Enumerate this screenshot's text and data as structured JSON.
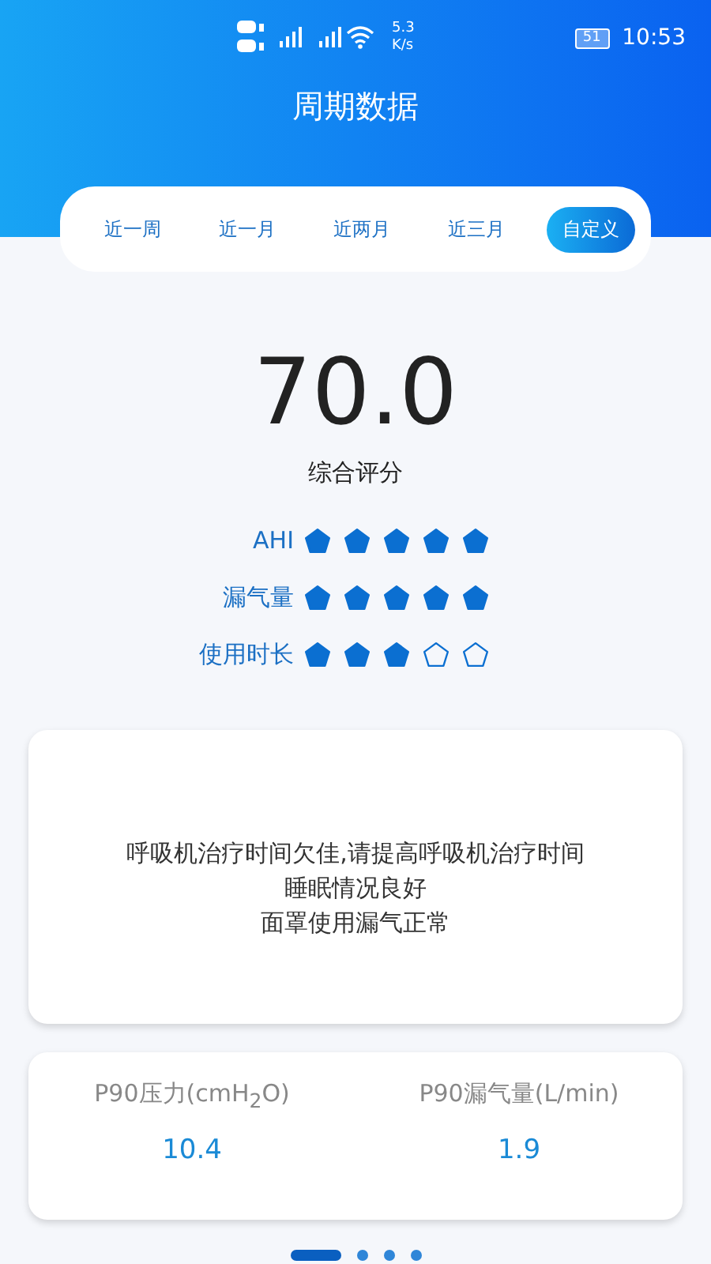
{
  "status_bar": {
    "speed_value": "5.3",
    "speed_unit": "K/s",
    "battery": "51",
    "time": "10:53"
  },
  "title": "周期数据",
  "tabs": [
    {
      "label": "近一周",
      "selected": false
    },
    {
      "label": "近一月",
      "selected": false
    },
    {
      "label": "近两月",
      "selected": false
    },
    {
      "label": "近三月",
      "selected": false
    },
    {
      "label": "自定义",
      "selected": true
    }
  ],
  "score": {
    "value": "70.0",
    "label": "综合评分"
  },
  "ratings": [
    {
      "label": "AHI",
      "stars": 5
    },
    {
      "label": "漏气量",
      "stars": 5
    },
    {
      "label": "使用时长",
      "stars": 3
    }
  ],
  "advice": [
    "呼吸机治疗时间欠佳,请提高呼吸机治疗时间",
    "睡眠情况良好",
    "面罩使用漏气正常"
  ],
  "metrics": [
    {
      "label": "P90压力(cmH$_{2}$O)",
      "value": "10.4"
    },
    {
      "label": "P90漏气量(L/min)",
      "value": "1.9"
    }
  ],
  "pages": [
    {
      "selected": true
    },
    {
      "selected": false
    },
    {
      "selected": false
    },
    {
      "selected": false
    }
  ]
}
